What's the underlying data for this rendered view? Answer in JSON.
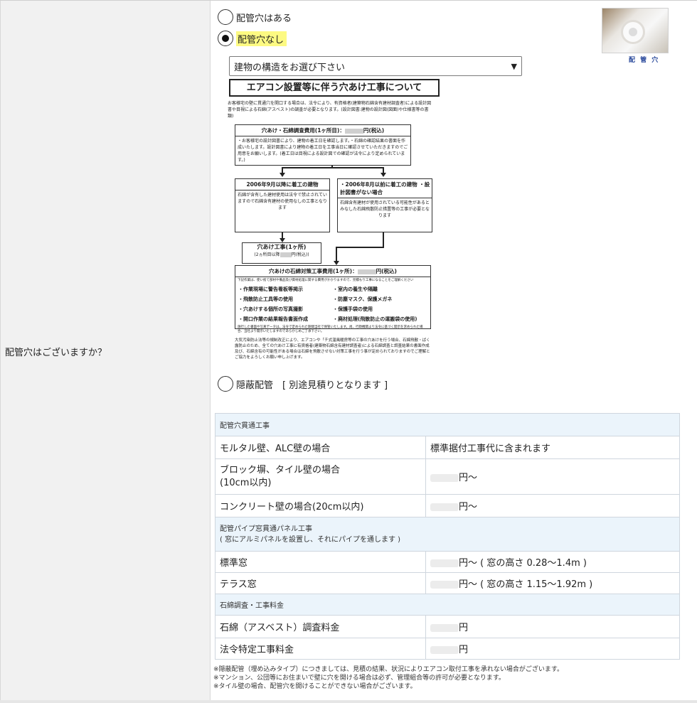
{
  "question_label": "配管穴はございますか？",
  "options": {
    "opt1": "配管穴はある",
    "opt2": "配管穴なし",
    "opt3": "隠蔽配管　[ 別途見積りとなります ]"
  },
  "thumb_caption": "配 管 穴",
  "select": {
    "value": "建物の構造をお選び下さい"
  },
  "flyer": {
    "title": "エアコン設置等に伴う穴あけ工事について",
    "intro": "お客様宅の壁に貫通穴を開口する場合は、法令により、有資格者(建築物石綿含有建材調査者)による設計図書や目視による石綿(アスベスト)の調査が必要となります。(設計図書:建物の設計図(図面)や仕様書等の書類)",
    "survey_head": "穴あけ・石綿調査費用(1ヶ所目)：",
    "survey_unit": "円(税込)",
    "survey_body": "・お客様宅の設計図書により、建物の着工日を確認します。・石綿の確認結果の書面を作成いたします。設計図書により建物の着工日を工事当日に確認させていただきますのでご用意をお願いします。(着工日は目視による設計図での確認が法令により定められています。)",
    "left_head": "2006年9月以降に着工の建物",
    "left_body": "石綿が含有した建材使用は法令で禁止されていますので石綿含有建材の使用なしの工事となります",
    "right_head": "・2006年8月以前に着工の建物 ・設計図書がない場合",
    "right_body": "石綿含有建材が使用されている可能性があるとみなした石綿飛散防止措置等の工事が必要となります",
    "hole_head": "穴あけ工事(1ヶ所)",
    "hole_sub": "(2ヵ所目以降",
    "hole_unit": "円(税込))",
    "measure_head": "穴あけの石綿対策工事費用(1ヶ所)：",
    "measure_unit": "円(税込)",
    "measure_note": "下記作業は、使い捨て部材や備品及び資材処理に関する費用がかかりますので、見積もり工事になることをご理解ください",
    "bullets": [
      "・作業現場に警告看板等掲示",
      "・室内の養生や隔離",
      "・飛散防止工具等の使用",
      "・防塵マスク、保護メガネ",
      "・穴あけする個所の写真撮影",
      "・保護手袋の使用",
      "・開口作業の結果報告書面作成",
      "・廃材処理(飛散防止の運搬袋の使用)"
    ],
    "measure_foot": "施行した書面や写真データは、法令で定められた期間当社で保管いたします。尚、行政機関より法令に基づく開示を求められた場合、当社より開示いたしますのであらかじめご了承下さい。",
    "bottom_note": "大気汚染防止法等の規制改正により、エアコンや「チ式温風暖房等の工事の穴あけを行う場合、石綿飛散・ばく露防止のため、全ての穴あけ工事に有資格者(建築物石綿含有建材調査者)による石綿調査と調査結果の書面作成及び、石綿含有の可能性がある場合は石綿を飛散させない対策工事を行う事が定められておりますのでご理解とご協力をよろしくお願い申し上げます。"
  },
  "table": {
    "sec1": "配管穴貫通工事",
    "r1": {
      "k": "モルタル壁、ALC壁の場合",
      "v": "標準据付工事代に含まれます"
    },
    "r2": {
      "k1": "ブロック塀、タイル壁の場合",
      "k2": "(10cm以内)",
      "v": "円～"
    },
    "r3": {
      "k": "コンクリート壁の場合(20cm以内)",
      "v": "円～"
    },
    "sec2a": "配管パイプ窓貫通パネル工事",
    "sec2b": "( 窓にアルミパネルを設置し、それにパイプを通します )",
    "r4": {
      "k": "標準窓",
      "v": "円～ ( 窓の高さ 0.28～1.4m )"
    },
    "r5": {
      "k": "テラス窓",
      "v": "円～ ( 窓の高さ 1.15～1.92m )"
    },
    "sec3": "石綿調査・工事料金",
    "r6": {
      "k": "石綿（アスベスト）調査料金",
      "v": "円"
    },
    "r7": {
      "k": "法令特定工事料金",
      "v": "円"
    }
  },
  "notes": [
    "※隠蔽配管（埋め込みタイプ）につきましては、見積の結果、状況によりエアコン取付工事を承れない場合がございます。",
    "※マンション、公団等にお住まいで壁に穴を開ける場合は必ず、管理組合等の許可が必要となります。",
    "※タイル壁の場合、配管穴を開けることができない場合がございます。"
  ]
}
